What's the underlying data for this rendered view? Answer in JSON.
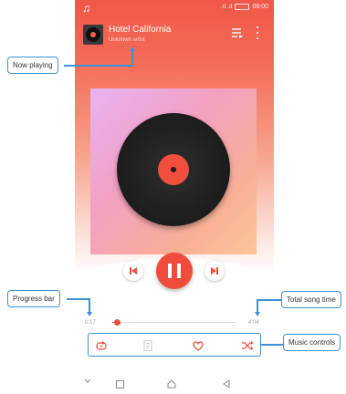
{
  "status_bar": {
    "time": "08:00",
    "signal": ".ıl .ıl"
  },
  "now_playing": {
    "title": "Hotel California",
    "artist": "Unknown artist"
  },
  "playback": {
    "elapsed": "0:17",
    "duration": "4:04",
    "progress": 0.04
  },
  "callouts": {
    "now_playing": "Now playing",
    "progress_bar": "Progress bar",
    "total_song_time": "Total song time",
    "music_controls": "Music controls"
  },
  "icons": {
    "status": "music-note-icon",
    "queue": "queue-icon",
    "more": "more-vertical-icon",
    "prev": "skip-previous-icon",
    "pause": "pause-icon",
    "next": "skip-next-icon",
    "repeat": "repeat-icon",
    "lyrics": "lyrics-icon",
    "favorite": "heart-icon",
    "shuffle": "shuffle-icon"
  },
  "colors": {
    "accent": "#f04b3b",
    "callout_border": "#3e91d6"
  }
}
